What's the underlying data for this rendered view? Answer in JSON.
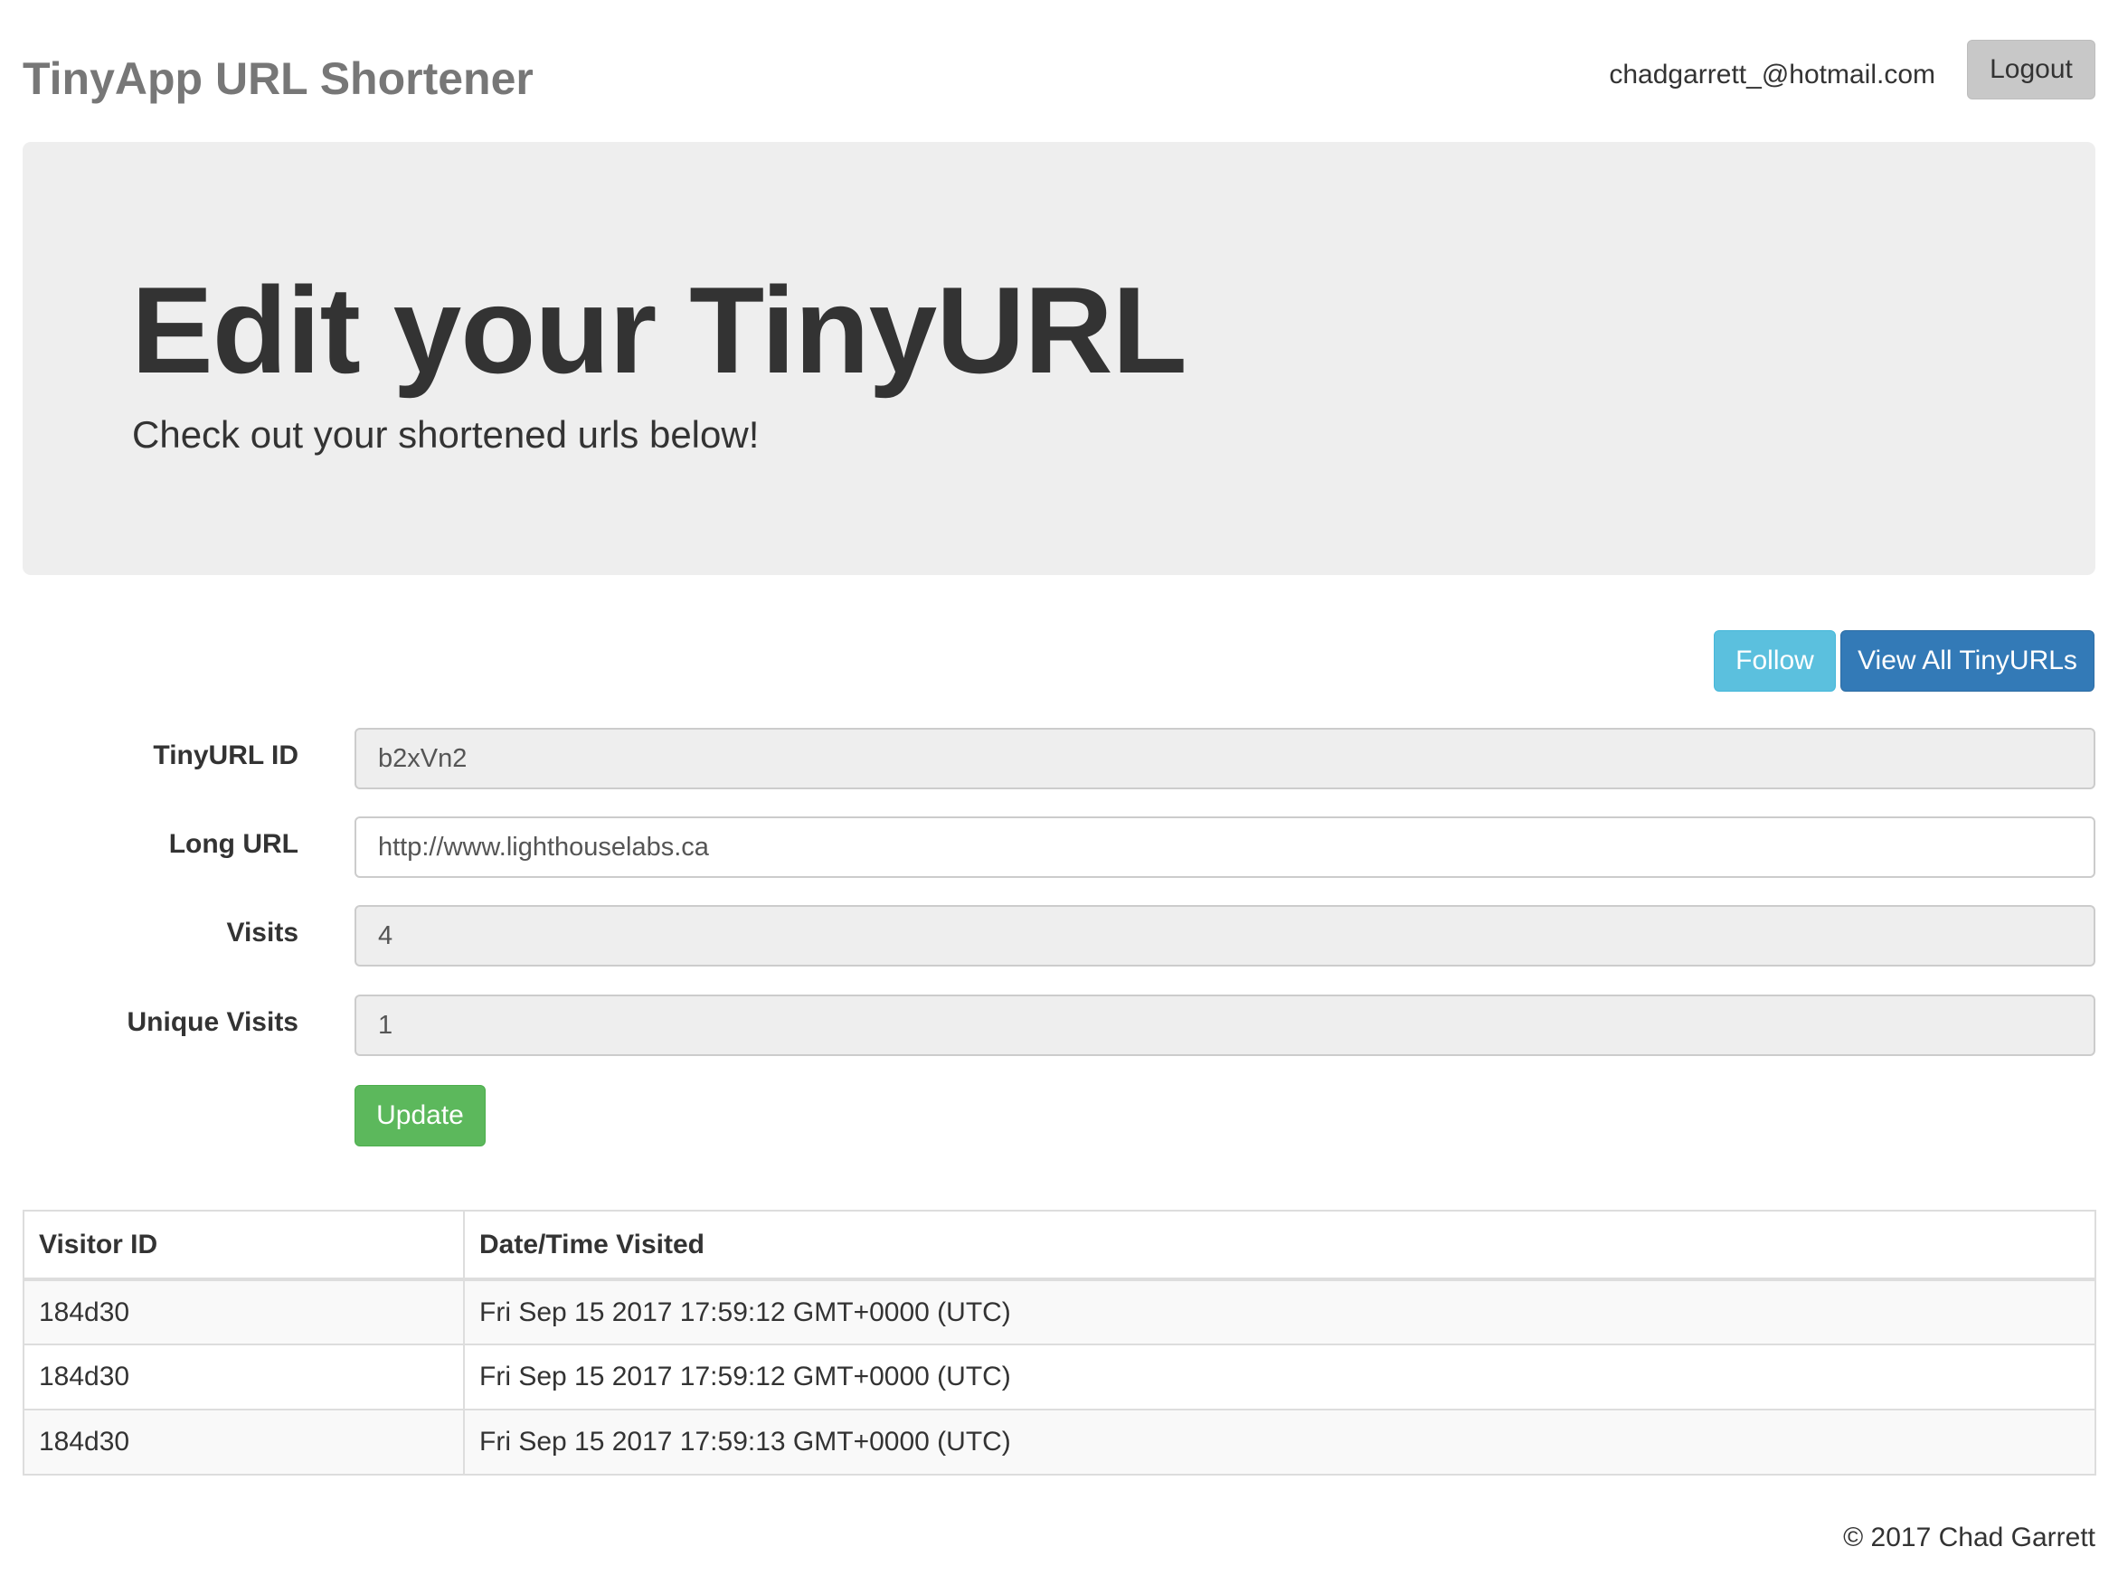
{
  "navbar": {
    "brand": "TinyApp URL Shortener",
    "user_email": "chadgarrett_@hotmail.com",
    "logout_label": "Logout"
  },
  "jumbotron": {
    "title": "Edit your TinyURL",
    "subtitle": "Check out your shortened urls below!"
  },
  "actions": {
    "follow_label": "Follow",
    "view_all_label": "View All TinyURLs"
  },
  "form": {
    "tinyurl_id": {
      "label": "TinyURL ID",
      "value": "b2xVn2"
    },
    "long_url": {
      "label": "Long URL",
      "value": "http://www.lighthouselabs.ca"
    },
    "visits": {
      "label": "Visits",
      "value": "4"
    },
    "unique_visits": {
      "label": "Unique Visits",
      "value": "1"
    },
    "update_label": "Update"
  },
  "visits_table": {
    "headers": [
      "Visitor ID",
      "Date/Time Visited"
    ],
    "rows": [
      [
        "184d30",
        "Fri Sep 15 2017 17:59:12 GMT+0000 (UTC)"
      ],
      [
        "184d30",
        "Fri Sep 15 2017 17:59:12 GMT+0000 (UTC)"
      ],
      [
        "184d30",
        "Fri Sep 15 2017 17:59:13 GMT+0000 (UTC)"
      ]
    ]
  },
  "footer": {
    "text": "© 2017 Chad Garrett"
  },
  "colors": {
    "follow": "#5bc0de",
    "view_all": "#337ab7",
    "update": "#5cb85c",
    "jumbotron_bg": "#eeeeee"
  }
}
